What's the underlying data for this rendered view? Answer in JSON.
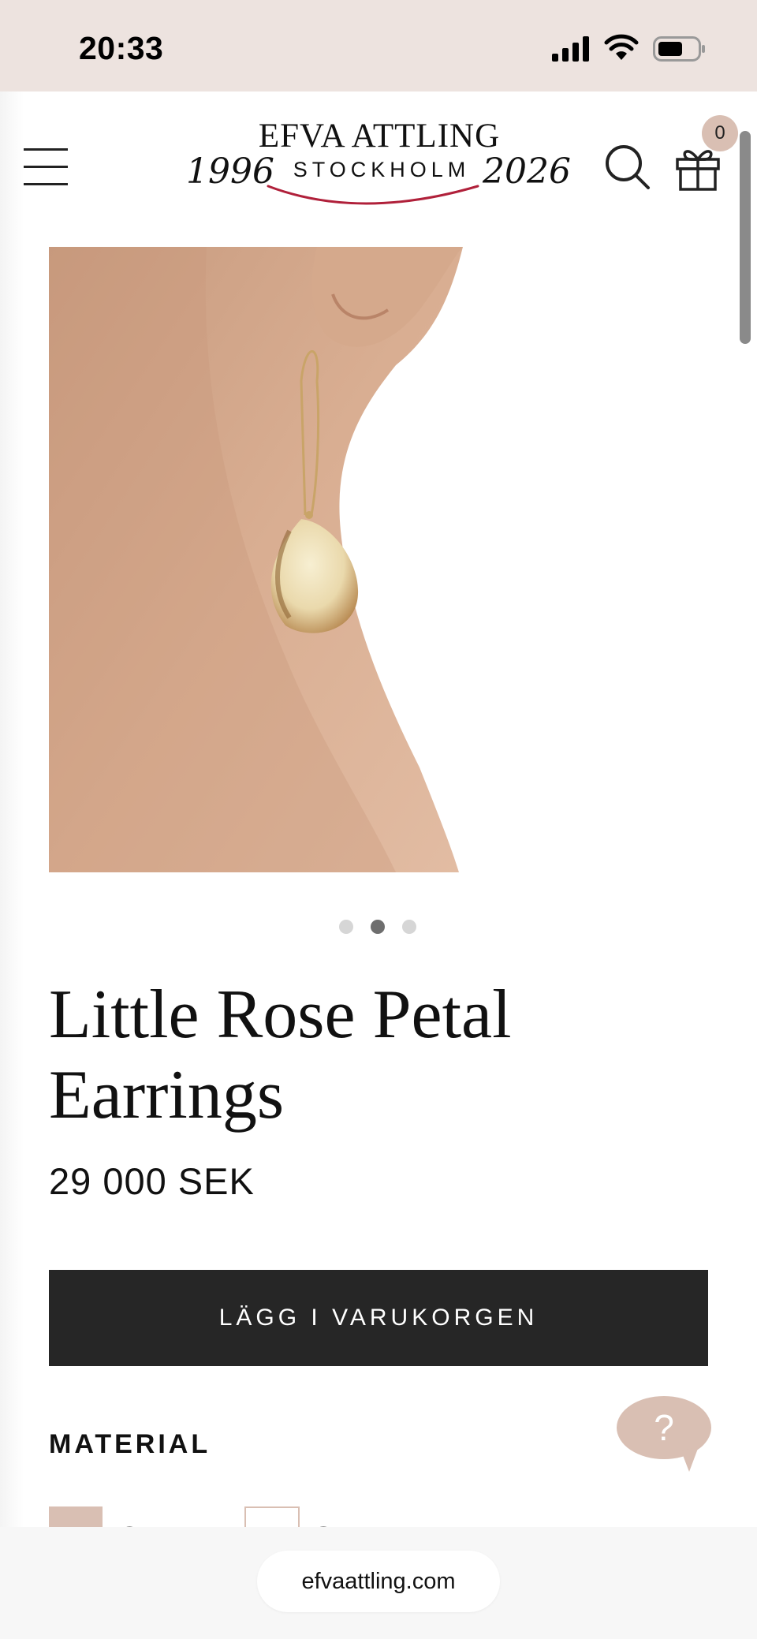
{
  "status_bar": {
    "time": "20:33"
  },
  "header": {
    "logo": {
      "brand": "EFVA ATTLING",
      "city": "STOCKHOLM",
      "year_start": "1996",
      "year_end": "2026"
    },
    "cart_count": "0",
    "icons": {
      "menu": "hamburger-menu-icon",
      "search": "search-icon",
      "cart": "gift-icon"
    }
  },
  "gallery": {
    "image_count": 3,
    "active_index": 1
  },
  "product": {
    "title": "Little Rose Petal Earrings",
    "price": "29 000 SEK",
    "add_to_cart_label": "LÄGG I VARUKORGEN",
    "material_heading": "MATERIAL",
    "materials": [
      "GULD",
      "SILVER"
    ]
  },
  "help": {
    "label": "?"
  },
  "browser": {
    "url": "efvaattling.com"
  },
  "colors": {
    "status_bar_bg": "#ede3df",
    "accent": "#d9bfb3",
    "button_bg": "#262626",
    "logo_swoosh": "#b0203a"
  }
}
